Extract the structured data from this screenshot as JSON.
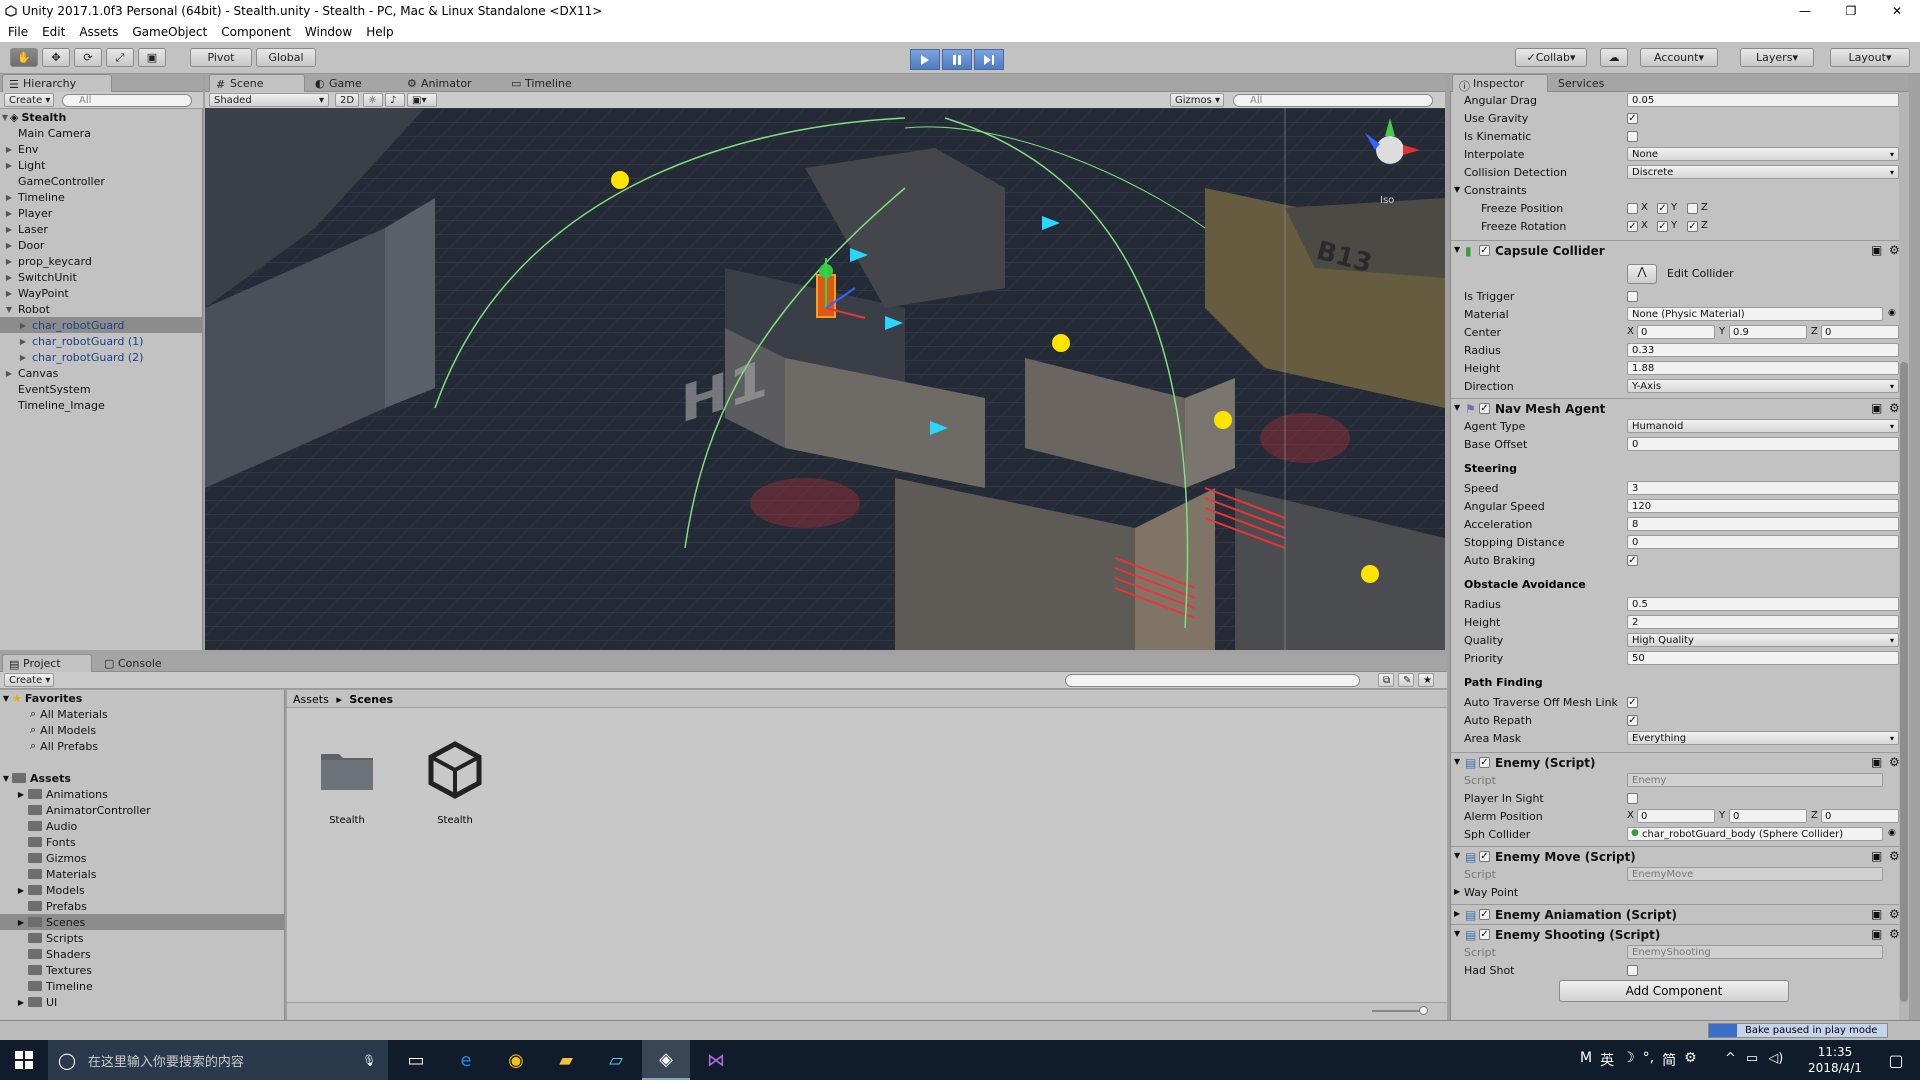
{
  "window": {
    "title": "Unity 2017.1.0f3 Personal (64bit) - Stealth.unity - Stealth - PC, Mac & Linux Standalone <DX11>",
    "minimize": "—",
    "maximize": "❐",
    "close": "✕"
  },
  "menu": [
    "File",
    "Edit",
    "Assets",
    "GameObject",
    "Component",
    "Window",
    "Help"
  ],
  "toolbar": {
    "pivot": "Pivot",
    "global": "Global",
    "collab": "Collab",
    "account": "Account",
    "layers": "Layers",
    "layout": "Layout"
  },
  "hierarchy": {
    "tab": "Hierarchy",
    "create": "Create",
    "search_placeholder": "All",
    "scene": "Stealth",
    "items": [
      {
        "label": "Main Camera",
        "arrow": ""
      },
      {
        "label": "Env",
        "arrow": "▶"
      },
      {
        "label": "Light",
        "arrow": "▶"
      },
      {
        "label": "GameController",
        "arrow": ""
      },
      {
        "label": "Timeline",
        "arrow": "▶"
      },
      {
        "label": "Player",
        "arrow": "▶"
      },
      {
        "label": "Laser",
        "arrow": "▶"
      },
      {
        "label": "Door",
        "arrow": "▶"
      },
      {
        "label": "prop_keycard",
        "arrow": "▶"
      },
      {
        "label": "SwitchUnit",
        "arrow": "▶"
      },
      {
        "label": "WayPoint",
        "arrow": "▶"
      },
      {
        "label": "Robot",
        "arrow": "▼"
      },
      {
        "label": "char_robotGuard",
        "arrow": "▶"
      },
      {
        "label": "char_robotGuard (1)",
        "arrow": "▶"
      },
      {
        "label": "char_robotGuard (2)",
        "arrow": "▶"
      },
      {
        "label": "Canvas",
        "arrow": "▶"
      },
      {
        "label": "EventSystem",
        "arrow": ""
      },
      {
        "label": "Timeline_Image",
        "arrow": ""
      }
    ]
  },
  "scene_view": {
    "tabs": [
      "Scene",
      "Game",
      "Animator",
      "Timeline"
    ],
    "shading": "Shaded",
    "mode_2d": "2D",
    "gizmos": "Gizmos",
    "search_placeholder": "All",
    "iso": "Iso",
    "decals": [
      "H1",
      "B13"
    ]
  },
  "project": {
    "tabs": [
      "Project",
      "Console"
    ],
    "create": "Create",
    "favorites_label": "Favorites",
    "favorites": [
      "All Materials",
      "All Models",
      "All Prefabs"
    ],
    "assets_label": "Assets",
    "assets": [
      "Animations",
      "AnimatorController",
      "Audio",
      "Fonts",
      "Gizmos",
      "Materials",
      "Models",
      "Prefabs",
      "Scenes",
      "Scripts",
      "Shaders",
      "Textures",
      "Timeline",
      "UI"
    ],
    "breadcrumb": [
      "Assets",
      "Scenes"
    ],
    "items": [
      {
        "label": "Stealth",
        "type": "folder"
      },
      {
        "label": "Stealth",
        "type": "unity-scene"
      }
    ]
  },
  "inspector": {
    "tabs": [
      "Inspector",
      "Services"
    ],
    "rigidbody": {
      "angular_drag_label": "Angular Drag",
      "angular_drag": "0.05",
      "use_gravity_label": "Use Gravity",
      "is_kinematic_label": "Is Kinematic",
      "interpolate_label": "Interpolate",
      "interpolate": "None",
      "collision_label": "Collision Detection",
      "collision": "Discrete",
      "constraints_label": "Constraints",
      "freeze_pos_label": "Freeze Position",
      "freeze_rot_label": "Freeze Rotation",
      "x": "X",
      "y": "Y",
      "z": "Z"
    },
    "capsule": {
      "title": "Capsule Collider",
      "edit": "Edit Collider",
      "is_trigger_label": "Is Trigger",
      "material_label": "Material",
      "material": "None (Physic Material)",
      "center_label": "Center",
      "cx": "0",
      "cy": "0.9",
      "cz": "0",
      "radius_label": "Radius",
      "radius": "0.33",
      "height_label": "Height",
      "height": "1.88",
      "direction_label": "Direction",
      "direction": "Y-Axis"
    },
    "nav": {
      "title": "Nav Mesh Agent",
      "agent_type_label": "Agent Type",
      "agent_type": "Humanoid",
      "base_offset_label": "Base Offset",
      "base_offset": "0",
      "steering": "Steering",
      "speed_label": "Speed",
      "speed": "3",
      "ang_speed_label": "Angular Speed",
      "ang_speed": "120",
      "accel_label": "Acceleration",
      "accel": "8",
      "stop_label": "Stopping Distance",
      "stop": "0",
      "brake_label": "Auto Braking",
      "obstacle": "Obstacle Avoidance",
      "o_radius_label": "Radius",
      "o_radius": "0.5",
      "o_height_label": "Height",
      "o_height": "2",
      "quality_label": "Quality",
      "quality": "High Quality",
      "priority_label": "Priority",
      "priority": "50",
      "pathfinding": "Path Finding",
      "traverse_label": "Auto Traverse Off Mesh Link",
      "repath_label": "Auto Repath",
      "area_label": "Area Mask",
      "area": "Everything"
    },
    "enemy": {
      "title": "Enemy (Script)",
      "script_label": "Script",
      "script": "Enemy",
      "sight_label": "Player In Sight",
      "alarm_label": "Alerm Position",
      "ax": "0",
      "ay": "0",
      "az": "0",
      "sph_label": "Sph Collider",
      "sph": "char_robotGuard_body (Sphere Collider)"
    },
    "enemy_move": {
      "title": "Enemy Move (Script)",
      "script_label": "Script",
      "script": "EnemyMove",
      "waypoint": "Way Point"
    },
    "enemy_anim": {
      "title": "Enemy Aniamation (Script)"
    },
    "enemy_shoot": {
      "title": "Enemy Shooting (Script)",
      "script_label": "Script",
      "script": "EnemyShooting",
      "had_shot_label": "Had Shot"
    },
    "add_component": "Add Component"
  },
  "status": {
    "bake": "Bake paused in play mode"
  },
  "taskbar": {
    "search_placeholder": "在这里输入你要搜索的内容",
    "time": "11:35",
    "date": "2018/4/1",
    "ime": "英",
    "ime2": "简",
    "ime_m": "M"
  },
  "colors": {
    "accent": "#4e7cc2",
    "selection": "#8c8c8c",
    "panel": "#c2c2c2",
    "taskbar": "#101c2b"
  }
}
